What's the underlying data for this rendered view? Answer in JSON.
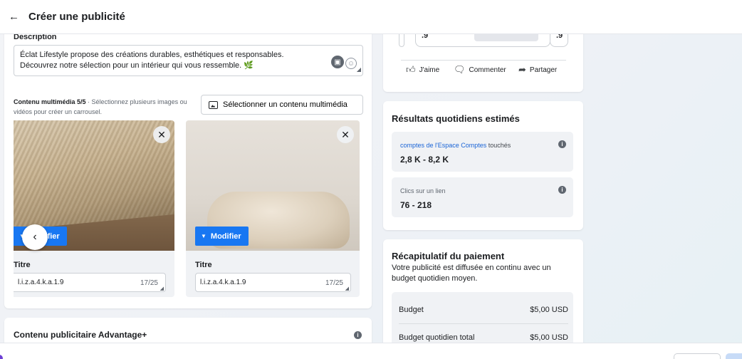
{
  "header": {
    "title": "Créer une publicité",
    "back_icon": "arrow-left-icon"
  },
  "description": {
    "label": "Description",
    "line1": "Éclat Lifestyle propose des créations durables, esthétiques et responsables.",
    "line2": "Découvrez notre sélection pour un intérieur qui vous ressemble. 🌿"
  },
  "media": {
    "label_bold": "Contenu multimédia 5/5",
    "label_help": " · Sélectionnez plusieurs images ou vidéos pour créer un carrousel.",
    "select_button": "Sélectionner un contenu multimédia",
    "cards": [
      {
        "modify_label": "Modifier",
        "title_label": "Titre",
        "title_value": "l.i.z.a.4.k.a.1.9",
        "count": "17/25"
      },
      {
        "modify_label": "Modifier",
        "title_label": "Titre",
        "title_value": "l.i.z.a.4.k.a.1.9",
        "count": "17/25"
      }
    ]
  },
  "advantage": {
    "title": "Contenu publicitaire Advantage+"
  },
  "preview": {
    "box1": ".9",
    "box2": ".9",
    "actions": {
      "like": "J'aime",
      "comment": "Commenter",
      "share": "Partager"
    }
  },
  "results": {
    "title": "Résultats quotidiens estimés",
    "reach_label_accent": "comptes de l'Espace Comptes",
    "reach_label_rest": " touchés",
    "reach_value": "2,8 K - 8,2 K",
    "clicks_label": "Clics sur un lien",
    "clicks_value": "76 - 218"
  },
  "payment": {
    "title": "Récapitulatif du paiement",
    "description": "Votre publicité est diffusée en continu avec un budget quotidien moyen.",
    "rows": [
      {
        "label": "Budget",
        "value": "$5,00 USD"
      },
      {
        "label": "Budget quotidien total",
        "value": "$5,00 USD"
      }
    ]
  },
  "colors": {
    "accent": "#1877f2",
    "link": "#1a64d6"
  }
}
